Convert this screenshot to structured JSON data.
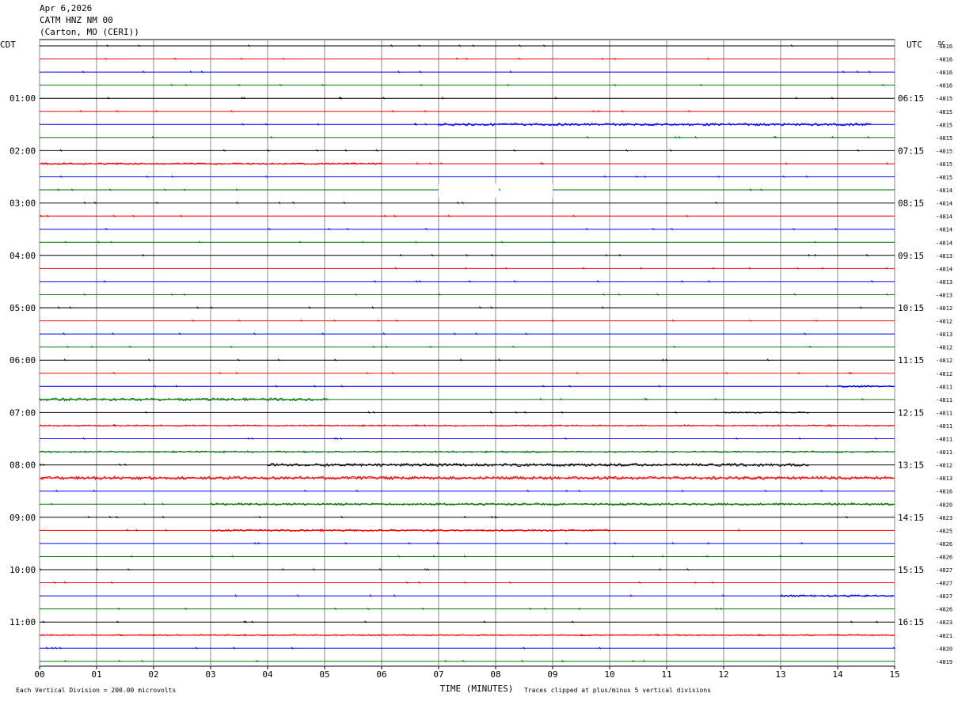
{
  "header": {
    "date": "Apr 6,2026",
    "station": "CATM HNZ NM 00",
    "location": "(Carton, MO (CERI))"
  },
  "chart_data": {
    "type": "line",
    "title": "",
    "xlabel": "TIME (MINUTES)",
    "x_ticks": [
      "00",
      "01",
      "02",
      "03",
      "04",
      "05",
      "06",
      "07",
      "08",
      "09",
      "10",
      "11",
      "12",
      "13",
      "14",
      "15"
    ],
    "xlim": [
      0,
      15
    ],
    "left_axis_label": "CDT",
    "right_axis_label": "UTC",
    "dc_label": "DC",
    "left_hour_labels": [
      "01:00",
      "02:00",
      "03:00",
      "04:00",
      "05:00",
      "06:00",
      "07:00",
      "08:00",
      "09:00",
      "10:00",
      "11:00"
    ],
    "right_hour_labels": [
      "06:15",
      "07:15",
      "08:15",
      "09:15",
      "10:15",
      "11:15",
      "12:15",
      "13:15",
      "14:15",
      "15:15",
      "16:15"
    ],
    "trace_colors": [
      "#000000",
      "#ff0000",
      "#0000ff",
      "#007700"
    ],
    "dc_offsets": [
      -4816,
      -4816,
      -4816,
      -4816,
      -4815,
      -4815,
      -4815,
      -4815,
      -4815,
      -4815,
      -4815,
      -4814,
      -4814,
      -4814,
      -4814,
      -4814,
      -4813,
      -4814,
      -4813,
      -4813,
      -4812,
      -4812,
      -4813,
      -4812,
      -4812,
      -4812,
      -4811,
      -4811,
      -4811,
      -4811,
      -4811,
      -4811,
      -4812,
      -4813,
      -4816,
      -4820,
      -4823,
      -4825,
      -4826,
      -4826,
      -4827,
      -4827,
      -4827,
      -4826,
      -4823,
      -4821,
      -4820,
      -4819
    ],
    "gap": {
      "trace": 11,
      "x_start": 7.0,
      "x_end": 9.0
    },
    "active_segments": [
      {
        "trace": 6,
        "x_start": 7.0,
        "x_end": 14.6,
        "level": 0.8
      },
      {
        "trace": 9,
        "x_start": 0.0,
        "x_end": 6.0,
        "level": 0.5
      },
      {
        "trace": 26,
        "x_start": 14.0,
        "x_end": 15.0,
        "level": 0.5
      },
      {
        "trace": 27,
        "x_start": 0.0,
        "x_end": 5.0,
        "level": 0.9
      },
      {
        "trace": 28,
        "x_start": 12.0,
        "x_end": 13.5,
        "level": 0.4
      },
      {
        "trace": 29,
        "x_start": 0.0,
        "x_end": 15.0,
        "level": 0.4
      },
      {
        "trace": 31,
        "x_start": 0.0,
        "x_end": 15.0,
        "level": 0.4
      },
      {
        "trace": 32,
        "x_start": 4.0,
        "x_end": 13.5,
        "level": 0.9
      },
      {
        "trace": 33,
        "x_start": 0.0,
        "x_end": 15.0,
        "level": 1.0
      },
      {
        "trace": 35,
        "x_start": 3.0,
        "x_end": 15.0,
        "level": 0.7
      },
      {
        "trace": 37,
        "x_start": 3.0,
        "x_end": 10.0,
        "level": 0.6
      },
      {
        "trace": 42,
        "x_start": 13.0,
        "x_end": 15.0,
        "level": 0.6
      },
      {
        "trace": 45,
        "x_start": 0.0,
        "x_end": 15.0,
        "level": 0.4
      }
    ],
    "grid": true
  },
  "footer": {
    "vertical_division": "Each Vertical Division =  200.00 microvolts",
    "clip_note": "Traces clipped at plus/minus 5 vertical divisions"
  }
}
